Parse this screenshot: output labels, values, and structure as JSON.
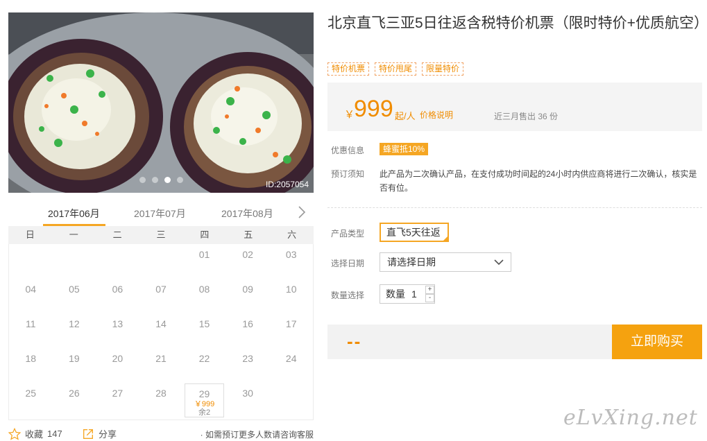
{
  "gallery": {
    "image_id": "ID:2057054",
    "dots": 4,
    "active_dot": 2
  },
  "calendar": {
    "months": [
      "2017年06月",
      "2017年07月",
      "2017年08月"
    ],
    "active_month": 0,
    "weekdays": [
      "日",
      "一",
      "二",
      "三",
      "四",
      "五",
      "六"
    ],
    "leading_blanks": 4,
    "days": [
      "01",
      "02",
      "03",
      "04",
      "05",
      "06",
      "07",
      "08",
      "09",
      "10",
      "11",
      "12",
      "13",
      "14",
      "15",
      "16",
      "17",
      "18",
      "19",
      "20",
      "21",
      "22",
      "23",
      "24",
      "25",
      "26",
      "27",
      "28",
      "29",
      "30"
    ],
    "available": {
      "day": "29",
      "price": "￥999",
      "stock": "余2"
    }
  },
  "footer": {
    "favorite_label": "收藏",
    "favorite_count": "147",
    "share_label": "分享",
    "consult_text": "· 如需预订更多人数请咨询客服"
  },
  "product": {
    "title": "北京直飞三亚5日往返含税特价机票（限时特价+优质航空）",
    "tags": [
      "特价机票",
      "特价甩尾",
      "限量特价"
    ]
  },
  "price": {
    "currency": "￥",
    "amount": "999",
    "unit": "起/人",
    "explain_link": "价格说明",
    "sold": "近三月售出 36 份"
  },
  "info": {
    "discount_label": "优惠信息",
    "discount_badge": "蜂蜜抵10%",
    "notice_label": "预订须知",
    "notice_text": "此产品为二次确认产品，在支付成功时间起的24小时内供应商将进行二次确认，核实是否有位。"
  },
  "options": {
    "type_label": "产品类型",
    "type_value": "直飞5天往返",
    "date_label": "选择日期",
    "date_placeholder": "请选择日期",
    "qty_label": "数量选择",
    "qty_prefix": "数量",
    "qty_value": "1",
    "plus": "+",
    "minus": "-"
  },
  "purchase": {
    "total": "--",
    "buy_label": "立即购买"
  },
  "watermark": "eLvXing.net",
  "colors": {
    "accent": "#f5a623",
    "price": "#f08c00"
  }
}
